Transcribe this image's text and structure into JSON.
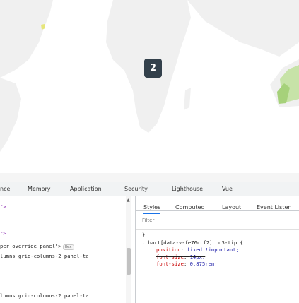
{
  "map": {
    "cluster_count": "2",
    "land_color": "#f0f0f0",
    "highlight_colors": {
      "green": "#a6d17a",
      "yellow": "#e6e67a"
    }
  },
  "devtools": {
    "tabs": [
      "nce",
      "Memory",
      "Application",
      "Security",
      "Lighthouse",
      "Vue"
    ],
    "elements": {
      "line1": "\">",
      "line2": "\">",
      "line3_prefix": "per override_panel\">",
      "line3_badge": "flex",
      "line4": "lumns grid-columns-2 panel-ta",
      "line5": "lumns grid-columns-2 panel-ta"
    },
    "styles_tabs": [
      "Styles",
      "Computed",
      "Layout",
      "Event Listen"
    ],
    "filter_placeholder": "Filter",
    "css": {
      "pre": "}",
      "selector": ".chart[data-v-fe76ccf2] .d3-tip {",
      "rule1_prop": "position",
      "rule1_val": "fixed !important;",
      "rule2_prop": "font-size",
      "rule2_val": "14px;",
      "rule3_prop": "font-size",
      "rule3_val": "0.875rem;"
    }
  }
}
